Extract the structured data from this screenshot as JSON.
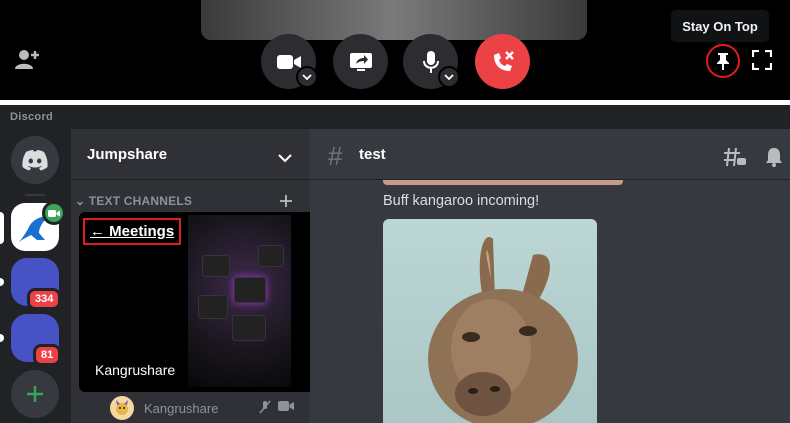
{
  "call_bar": {
    "tooltip": "Stay On Top",
    "controls": [
      "camera",
      "screen-share",
      "microphone",
      "disconnect"
    ]
  },
  "app": {
    "wordmark": "Discord",
    "servers": [
      {
        "name": "Direct Messages"
      },
      {
        "name": "Jumpshare",
        "badge": ""
      },
      {
        "name": "Server",
        "badge": "334"
      },
      {
        "name": "Server",
        "badge": "81"
      }
    ],
    "server_name": "Jumpshare",
    "category": "TEXT CHANNELS",
    "popout": {
      "back_label": "← Meetings",
      "streamer": "Kangrushare"
    },
    "voice_user": "Kangrushare",
    "channel": {
      "name": "test",
      "message": "Buff kangaroo incoming!"
    }
  },
  "colors": {
    "danger": "#ed4245",
    "blurple": "#5865f2",
    "green": "#3ba55c",
    "highlight": "#e21b1b"
  }
}
